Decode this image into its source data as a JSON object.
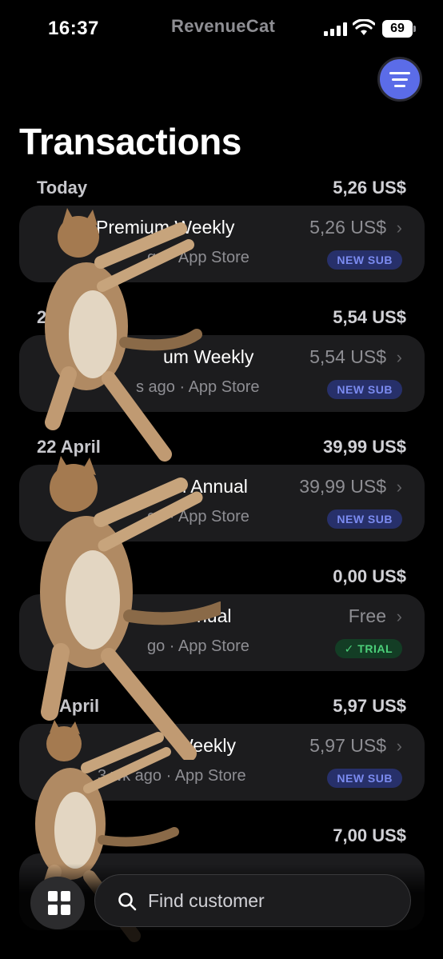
{
  "status_bar": {
    "time": "16:37",
    "app_name": "RevenueCat",
    "battery": "69"
  },
  "page": {
    "title": "Transactions"
  },
  "sections": [
    {
      "date": "Today",
      "total": "5,26 US$",
      "tx": {
        "title": "Premium Weekly",
        "sub": "go · App Store",
        "amount": "5,26 US$",
        "badge": "NEW SUB",
        "badge_type": "new"
      }
    },
    {
      "date": "2",
      "total": "5,54 US$",
      "tx": {
        "title": "um Weekly",
        "sub": "s ago · App Store",
        "amount": "5,54 US$",
        "badge": "NEW SUB",
        "badge_type": "new"
      }
    },
    {
      "date": "22 April",
      "total": "39,99 US$",
      "tx": {
        "title": "m Annual",
        "sub": "go · App Store",
        "amount": "39,99 US$",
        "badge": "NEW SUB",
        "badge_type": "new"
      }
    },
    {
      "date": "",
      "total": "0,00 US$",
      "tx": {
        "title": "nual",
        "sub": "go · App Store",
        "amount": "Free",
        "badge": "✓ TRIAL",
        "badge_type": "trial"
      }
    },
    {
      "date": "April",
      "total": "5,97 US$",
      "tx": {
        "title": "Weekly",
        "sub": "3 wk ago · App Store",
        "amount": "5,97 US$",
        "badge": "NEW SUB",
        "badge_type": "new"
      }
    },
    {
      "date": "",
      "total": "7,00 US$",
      "tx": {
        "title": "",
        "sub": "",
        "amount": "",
        "badge": "",
        "badge_type": "new"
      }
    }
  ],
  "search": {
    "placeholder": "Find customer"
  },
  "colors": {
    "accent": "#5b6ce8",
    "background": "#000000",
    "card": "#1c1c1e",
    "new_badge": "#7b8bf0",
    "trial_badge": "#4cd07a"
  },
  "icons": {
    "filter": "filter-lines-icon",
    "search": "search-icon",
    "grid": "grid-icon",
    "chevron": "chevron-right-icon"
  }
}
